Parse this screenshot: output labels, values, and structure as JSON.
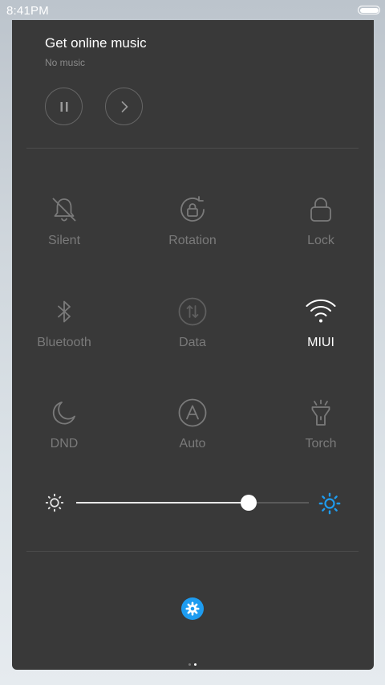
{
  "status_bar": {
    "time": "8:41PM",
    "battery_level": 1.0
  },
  "music": {
    "title": "Get online music",
    "subtitle": "No music",
    "controls": [
      {
        "name": "pause",
        "icon": "pause-icon"
      },
      {
        "name": "next",
        "icon": "chevron-right-icon"
      }
    ]
  },
  "toggles": [
    {
      "label": "Silent",
      "icon": "bell-off-icon",
      "state": "off"
    },
    {
      "label": "Rotation",
      "icon": "rotation-lock-icon",
      "state": "off"
    },
    {
      "label": "Lock",
      "icon": "lock-icon",
      "state": "off"
    },
    {
      "label": "Bluetooth",
      "icon": "bluetooth-icon",
      "state": "off"
    },
    {
      "label": "Data",
      "icon": "mobile-data-icon",
      "state": "disabled"
    },
    {
      "label": "MIUI",
      "icon": "wifi-icon",
      "state": "on"
    },
    {
      "label": "DND",
      "icon": "moon-icon",
      "state": "off"
    },
    {
      "label": "Auto",
      "icon": "auto-brightness-icon",
      "state": "off"
    },
    {
      "label": "Torch",
      "icon": "flashlight-icon",
      "state": "off"
    }
  ],
  "brightness": {
    "level": 0.74,
    "low_icon": "brightness-low-icon",
    "high_icon": "brightness-high-icon"
  },
  "settings": {
    "icon": "gear-icon"
  },
  "pager": {
    "pages": 2,
    "current": 2
  },
  "colors": {
    "panel_bg": "#393939",
    "accent": "#1e9cf0",
    "label_inactive": "#7a7a7a",
    "label_active": "#ffffff"
  }
}
